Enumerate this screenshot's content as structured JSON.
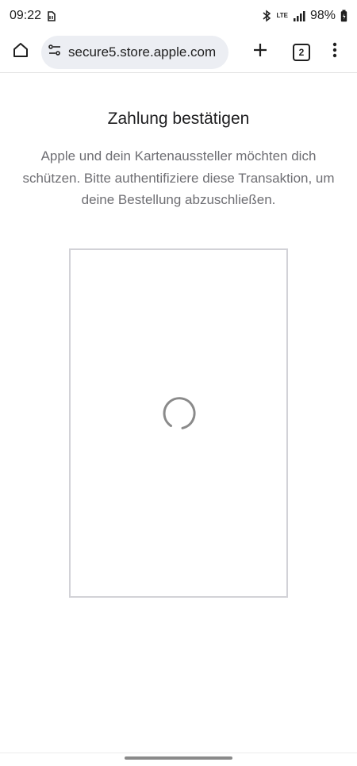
{
  "status_bar": {
    "time": "09:22",
    "network": "LTE",
    "battery_percent": "98%"
  },
  "browser": {
    "url": "secure5.store.apple.com",
    "tab_count": "2",
    "icons": {
      "home": "home-icon",
      "site_settings": "site-settings-icon",
      "new_tab": "plus-icon",
      "menu": "more-vert-icon"
    }
  },
  "page": {
    "title": "Zahlung bestätigen",
    "description": "Apple und dein Kartenaussteller möchten dich schützen. Bitte authentifiziere diese Transaktion, um deine Bestellung abzuschließen."
  },
  "colors": {
    "background": "#ffffff",
    "title_text": "#1d1d1f",
    "secondary_text": "#6e6e73",
    "frame_border": "#d2d2d7",
    "omnibox_bg": "#eceef3"
  }
}
